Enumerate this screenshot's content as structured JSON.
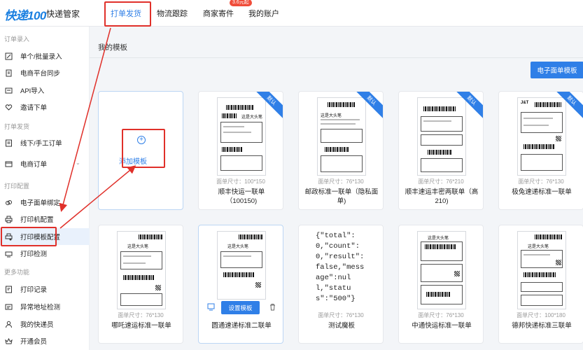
{
  "topbar": {
    "logo": "快递100",
    "brand": "快递管家",
    "tabs": [
      {
        "label": "打单发货"
      },
      {
        "label": "物流跟踪"
      },
      {
        "label": "商家寄件"
      },
      {
        "label": "我的账户"
      }
    ],
    "badge": "3.6元起"
  },
  "sidebar": {
    "sections": [
      "订单录入",
      "打单发货",
      "打印配置",
      "更多功能"
    ],
    "items": [
      {
        "label": "单个/批量录入",
        "icon": "edit-icon"
      },
      {
        "label": "电商平台同步",
        "icon": "sync-icon"
      },
      {
        "label": "API导入",
        "icon": "api-icon"
      },
      {
        "label": "邀请下单",
        "icon": "invite-icon"
      },
      {
        "label": "线下/手工订单",
        "icon": "manual-order-icon"
      },
      {
        "label": "电商订单",
        "icon": "ecommerce-order-icon"
      },
      {
        "label": "电子面单绑定",
        "icon": "link-icon"
      },
      {
        "label": "打印机配置",
        "icon": "printer-icon"
      },
      {
        "label": "打印模板配置",
        "icon": "template-icon"
      },
      {
        "label": "打印检测",
        "icon": "print-check-icon"
      },
      {
        "label": "打印记录",
        "icon": "record-icon"
      },
      {
        "label": "异常地址检测",
        "icon": "address-check-icon"
      },
      {
        "label": "我的快递员",
        "icon": "courier-icon"
      },
      {
        "label": "开通会员",
        "icon": "vip-icon"
      }
    ]
  },
  "main": {
    "title": "我的模板",
    "primary_button": "电子面单模板",
    "add_template": "添加模板",
    "default_label": "默认",
    "set_template": "设置模板",
    "json_sample": "{\"total\":0,\"count\":0,\"result\":false,\"message\":null,\"status\":\"500\"}",
    "cards": [
      {
        "size": "面单尺寸：100*150",
        "name": "顺丰快运一联单（100150)",
        "default": true
      },
      {
        "size": "面单尺寸：76*130",
        "name": "邮政标准一联单（隐私面单)",
        "default": true
      },
      {
        "size": "面单尺寸：76*210",
        "name": "顺丰速运丰密两联单（高210)",
        "default": true
      },
      {
        "size": "面单尺寸：76*130",
        "name": "极兔速递标准一联单",
        "default": true
      },
      {
        "size": "面单尺寸：76*130",
        "name": "哪吒速运标准一联单",
        "default": false
      },
      {
        "size": "",
        "name": "圆通速递标准二联单",
        "default": false
      },
      {
        "size": "面单尺寸：76*130",
        "name": "测试魔板",
        "default": false
      },
      {
        "size": "面单尺寸：76*130",
        "name": "中通快运标准一联单",
        "default": false
      },
      {
        "size": "面单尺寸：100*180",
        "name": "德邦快递标准三联单",
        "default": false
      }
    ],
    "thumb_text": {
      "dbd": "这是大头笔",
      "jt": "J&T"
    }
  },
  "colors": {
    "accent": "#2f7fe7",
    "annotation": "#e0302a",
    "badge": "#f04d3a"
  }
}
